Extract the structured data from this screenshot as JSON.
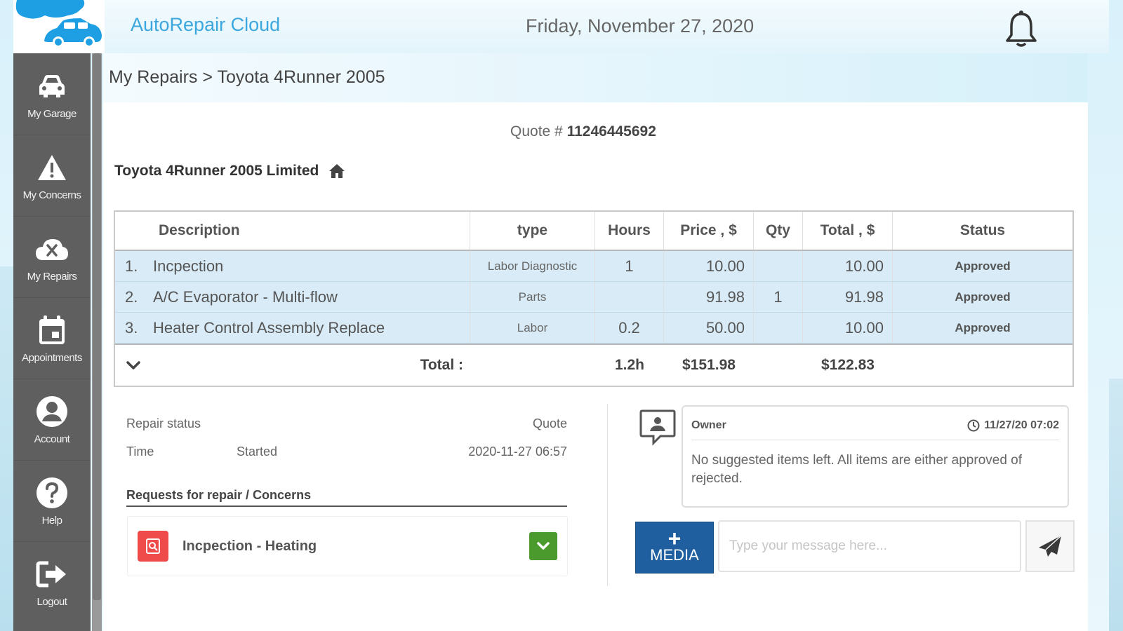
{
  "header": {
    "app_title": "AutoRepair Cloud",
    "date": "Friday, November 27, 2020",
    "bell_icon": "bell-icon"
  },
  "sidebar": {
    "items": [
      {
        "label": "My Garage",
        "icon": "car-icon"
      },
      {
        "label": "My Concerns",
        "icon": "warning-icon"
      },
      {
        "label": "My Repairs",
        "icon": "repair-cloud-icon"
      },
      {
        "label": "Appointments",
        "icon": "calendar-icon"
      },
      {
        "label": "Account",
        "icon": "user-icon"
      },
      {
        "label": "Help",
        "icon": "help-icon"
      },
      {
        "label": "Logout",
        "icon": "logout-icon"
      }
    ]
  },
  "breadcrumb": "My Repairs > Toyota 4Runner 2005",
  "quote": {
    "label": "Quote #",
    "number": "11246445692"
  },
  "vehicle": "Toyota 4Runner 2005 Limited",
  "table": {
    "headers": [
      "Description",
      "type",
      "Hours",
      "Price , $",
      "Qty",
      "Total , $",
      "Status"
    ],
    "rows": [
      {
        "num": "1.",
        "description": "Incpection",
        "type": "Labor Diagnostic",
        "hours": "1",
        "price": "10.00",
        "qty": "",
        "total": "10.00",
        "status": "Approved"
      },
      {
        "num": "2.",
        "description": "A/C Evaporator - Multi-flow",
        "type": "Parts",
        "hours": "",
        "price": "91.98",
        "qty": "1",
        "total": "91.98",
        "status": "Approved"
      },
      {
        "num": "3.",
        "description": "Heater Control Assembly Replace",
        "type": "Labor",
        "hours": "0.2",
        "price": "50.00",
        "qty": "",
        "total": "10.00",
        "status": "Approved"
      }
    ],
    "footer": {
      "label": "Total :",
      "hours": "1.2h",
      "price": "$151.98",
      "total": "$122.83"
    }
  },
  "repair_info": {
    "status_label": "Repair status",
    "status_value": "Quote",
    "time_label": "Time",
    "time_state": "Started",
    "time_value": "2020-11-27 06:57"
  },
  "requests": {
    "title": "Requests for repair / Concerns",
    "items": [
      {
        "label": "Incpection - Heating"
      }
    ]
  },
  "chat": {
    "author": "Owner",
    "time": "11/27/20 07:02",
    "message": "No suggested items left. All items are either approved of rejected.",
    "media_label": "MEDIA",
    "input_placeholder": "Type your message here..."
  },
  "colors": {
    "brand": "#3ba7de",
    "sidebar": "#5f5f5f",
    "row_highlight": "#d8ebf6",
    "media_button": "#1f5f9f",
    "request_icon": "#ef4b4b",
    "toggle": "#4a9a2e"
  }
}
